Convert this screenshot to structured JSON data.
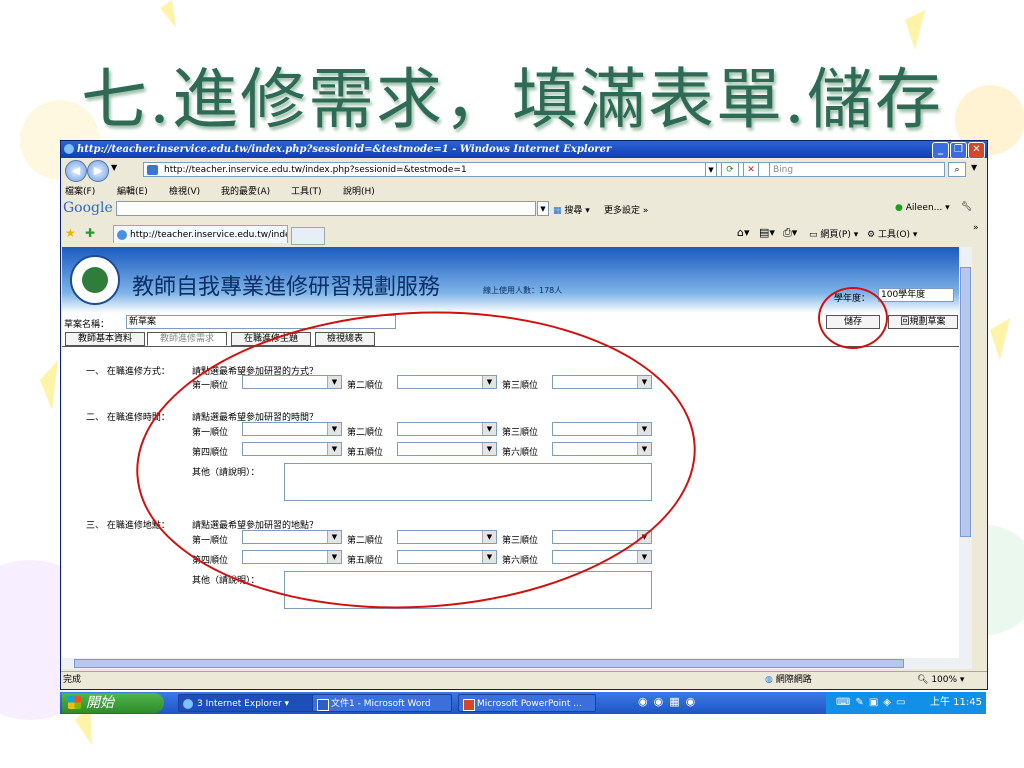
{
  "slide": {
    "title": "七.進修需求，填滿表單.儲存"
  },
  "window": {
    "title": "http://teacher.inservice.edu.tw/index.php?sessionid=&testmode=1 - Windows Internet Explorer",
    "address": "http://teacher.inservice.edu.tw/index.php?sessionid=&testmode=1",
    "search_box": "Bing",
    "menu": [
      "檔案(F)",
      "編輯(E)",
      "檢視(V)",
      "我的最愛(A)",
      "工具(T)",
      "說明(H)"
    ],
    "google_logo": "Google",
    "google_search": "搜尋",
    "google_more": "更多設定 »",
    "google_user": "Aileen...",
    "tab_label": "http://teacher.inservice.edu.tw/index.php?sessionid=&te...",
    "cmd_page": "網頁(P)",
    "cmd_tools": "工具(O)",
    "status_left": "完成",
    "status_zone": "網際網路",
    "status_zoom": "100%"
  },
  "page": {
    "banner_title": "教師自我專業進修研習規劃服務",
    "online_count": "線上使用人數：178人",
    "year_label": "學年度：",
    "year_value": "100學年度",
    "draft_label": "草案名稱：",
    "draft_value": "新草案",
    "save_button": "儲存",
    "back_button": "回規劃草案",
    "tabs": [
      "教師基本資料",
      "教師進修需求",
      "在職進修主題",
      "檢視總表"
    ],
    "s1_heading": "一、 在職進修方式：",
    "s1_prompt": "請點選最希望參加研習的方式？",
    "s2_heading": "二、 在職進修時間：",
    "s2_prompt": "請點選最希望參加研習的時間？",
    "s3_heading": "三、 在職進修地點：",
    "s3_prompt": "請點選最希望參加研習的地點？",
    "rank": [
      "第一順位",
      "第二順位",
      "第三順位",
      "第四順位",
      "第五順位",
      "第六順位"
    ],
    "other_label": "其他（請說明）："
  },
  "taskbar": {
    "start": "開始",
    "task1": "3 Internet Explorer",
    "task2": "文件1 - Microsoft Word",
    "task3": "Microsoft PowerPoint ...",
    "clock": "上午 11:45"
  }
}
